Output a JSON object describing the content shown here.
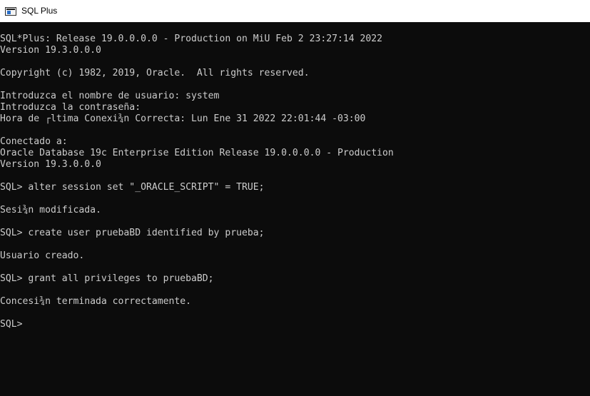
{
  "window": {
    "title": "SQL Plus",
    "icon": "console-window-icon"
  },
  "console": {
    "lines": [
      "SQL*Plus: Release 19.0.0.0.0 - Production on MiÚ Feb 2 23:27:14 2022",
      "Version 19.3.0.0.0",
      "",
      "Copyright (c) 1982, 2019, Oracle.  All rights reserved.",
      "",
      "Introduzca el nombre de usuario: system",
      "Introduzca la contraseña:",
      "Hora de ┌ltima Conexi¾n Correcta: Lun Ene 31 2022 22:01:44 -03:00",
      "",
      "Conectado a:",
      "Oracle Database 19c Enterprise Edition Release 19.0.0.0.0 - Production",
      "Version 19.3.0.0.0",
      "",
      "SQL> alter session set \"_ORACLE_SCRIPT\" = TRUE;",
      "",
      "Sesi¾n modificada.",
      "",
      "SQL> create user pruebaBD identified by prueba;",
      "",
      "Usuario creado.",
      "",
      "SQL> grant all privileges to pruebaBD;",
      "",
      "Concesi¾n terminada correctamente.",
      "",
      "SQL>"
    ]
  },
  "colors": {
    "background": "#0c0c0c",
    "text": "#cccccc",
    "titlebar": "#ffffff"
  }
}
